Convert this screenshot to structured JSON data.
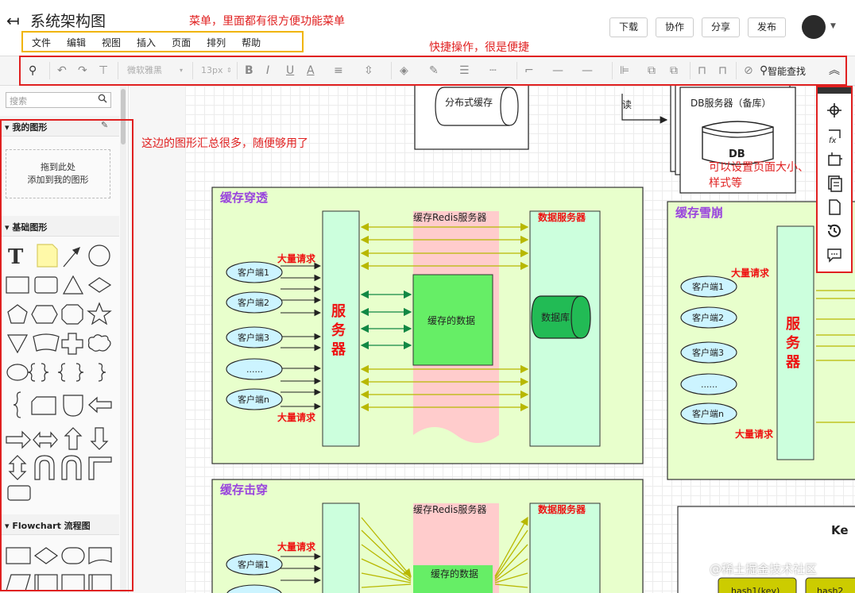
{
  "header": {
    "title": "系统架构图",
    "menus": [
      "文件",
      "编辑",
      "视图",
      "插入",
      "页面",
      "排列",
      "帮助"
    ],
    "buttons": {
      "download": "下载",
      "collab": "协作",
      "share": "分享",
      "publish": "发布"
    }
  },
  "toolbar": {
    "font_family": "微软雅黑",
    "font_size": "13px",
    "smart_find": "智能查找"
  },
  "sidebar": {
    "search_placeholder": "搜索",
    "my_shapes": "我的图形",
    "drop_line1": "拖到此处",
    "drop_line2": "添加到我的图形",
    "basic_shapes": "基础图形",
    "flowchart": "Flowchart 流程图"
  },
  "annotations": {
    "menu": "菜单，里面都有很方便功能菜单",
    "toolbar": "快捷操作，很是便捷",
    "shapes": "这边的图形汇总很多，随便够用了",
    "page_settings_1": "可以设置页面大小、",
    "page_settings_2": "样式等"
  },
  "diagram": {
    "dist_cache": "分布式缓存",
    "read": "读",
    "db_backup": "DB服务器（备库）",
    "db": "DB",
    "penetration": {
      "title": "缓存穿透",
      "redis": "缓存Redis服务器",
      "data_server": "数据服务器",
      "big_req_top": "大量请求",
      "big_req_bottom": "大量请求",
      "server": "服务器",
      "cached": "缓存的数据",
      "database": "数据库",
      "clients": [
        "客户端1",
        "客户端2",
        "客户端3",
        "......",
        "客户端n"
      ]
    },
    "avalanche": {
      "title": "缓存雪崩",
      "big_req_top": "大量请求",
      "big_req_bottom": "大量请求",
      "server": "服务器",
      "clients": [
        "客户端1",
        "客户端2",
        "客户端3",
        "......",
        "客户端n"
      ]
    },
    "breakdown": {
      "title": "缓存击穿",
      "redis": "缓存Redis服务器",
      "data_server": "数据服务器",
      "big_req": "大量请求",
      "cached": "缓存的数据",
      "client1": "客户端1"
    },
    "ke": "Ke",
    "hash1": "hash1(key)",
    "hash2": "hash2"
  },
  "watermark": "@稀土掘金技术社区"
}
